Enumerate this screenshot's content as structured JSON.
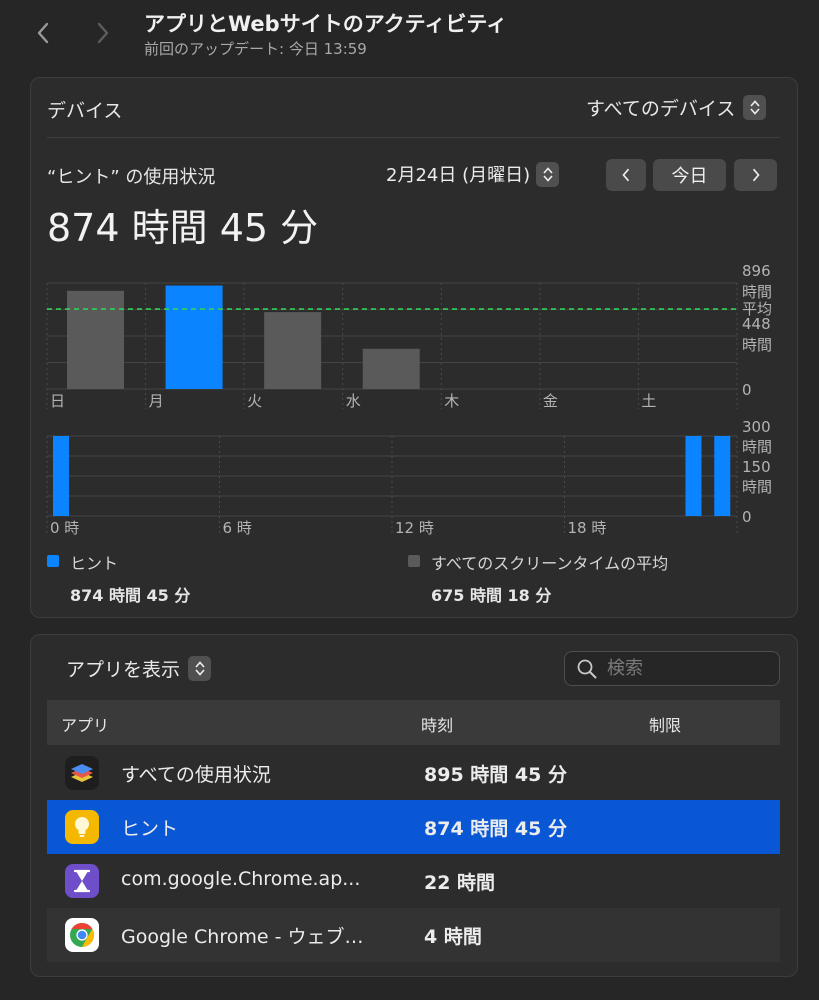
{
  "header": {
    "title": "アプリとWebサイトのアクティビティ",
    "last_update_label": "前回のアップデート:",
    "last_update_value": "今日 13:59"
  },
  "device_panel": {
    "device_label": "デバイス",
    "device_select": "すべてのデバイス",
    "usage_title": "“ヒント” の使用状況",
    "date": "2月24日 (月曜日)",
    "today_button": "今日",
    "total_time": "874 時間 45 分"
  },
  "chart_data": [
    {
      "type": "bar",
      "title": "",
      "categories": [
        "日",
        "月",
        "火",
        "水",
        "木",
        "金",
        "土"
      ],
      "series": [
        {
          "name": "ヒント",
          "values": [
            0,
            874.75,
            0,
            0,
            0,
            0,
            0
          ],
          "color": "#0a84ff"
        },
        {
          "name": "すべてのスクリーンタイムの平均",
          "values": [
            830,
            0,
            650,
            340,
            0,
            0,
            0
          ],
          "color": "#5a5a5a"
        }
      ],
      "average": 675.3,
      "average_label": "平均",
      "average_color": "#30d158",
      "y_ticks": [
        {
          "value": 896,
          "line1": "896",
          "line2": "時間"
        },
        {
          "value": 448,
          "line1": "448",
          "line2": "時間"
        },
        {
          "value": 0,
          "line1": "0",
          "line2": ""
        }
      ],
      "ylim": [
        0,
        896
      ],
      "grid": true
    },
    {
      "type": "bar",
      "title": "",
      "x": [
        0,
        22,
        23
      ],
      "values": [
        300,
        300,
        300
      ],
      "color": "#0a84ff",
      "x_ticks": [
        {
          "hour": 0,
          "label": "0 時"
        },
        {
          "hour": 6,
          "label": "6 時"
        },
        {
          "hour": 12,
          "label": "12 時"
        },
        {
          "hour": 18,
          "label": "18 時"
        }
      ],
      "y_ticks": [
        {
          "value": 300,
          "line1": "300",
          "line2": "時間"
        },
        {
          "value": 150,
          "line1": "150",
          "line2": "時間"
        },
        {
          "value": 0,
          "line1": "0",
          "line2": ""
        }
      ],
      "ylim": [
        0,
        300
      ],
      "grid": true
    }
  ],
  "legend": {
    "hint_label": "ヒント",
    "hint_value": "874 時間 45 分",
    "hint_color": "#0a84ff",
    "avg_label": "すべてのスクリーンタイムの平均",
    "avg_value": "675 時間 18 分",
    "avg_color": "#5a5a5a"
  },
  "apps_panel": {
    "show_apps_label": "アプリを表示",
    "search_placeholder": "検索",
    "columns": [
      "アプリ",
      "時刻",
      "制限"
    ],
    "rows": [
      {
        "name": "すべての使用状況",
        "time": "895 時間 45 分",
        "icon": "layers-stack-icon",
        "selected": false
      },
      {
        "name": "ヒント",
        "time": "874 時間 45 分",
        "icon": "lightbulb-icon",
        "selected": true
      },
      {
        "name": "com.google.Chrome.ap...",
        "time": "22 時間",
        "icon": "hourglass-icon",
        "selected": false
      },
      {
        "name": "Google Chrome - ウェブ…",
        "time": "4 時間",
        "icon": "chrome-icon",
        "selected": false
      }
    ],
    "selected_color": "#0a57d6"
  }
}
